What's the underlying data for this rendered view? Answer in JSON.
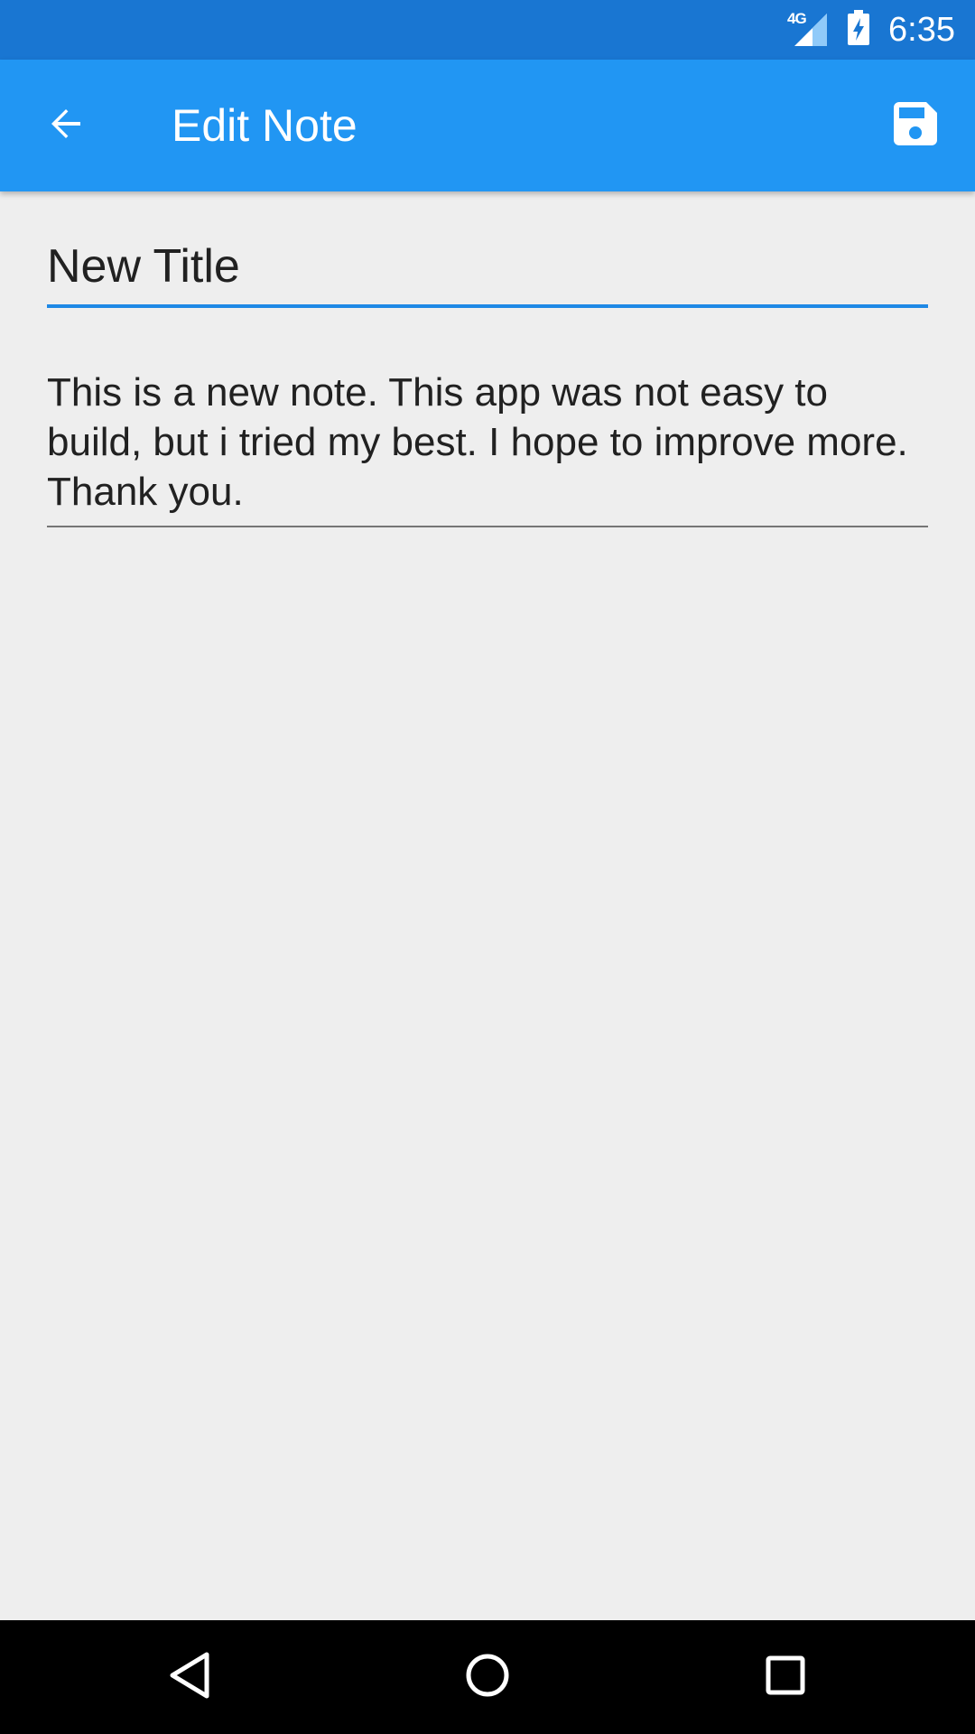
{
  "status_bar": {
    "network_type": "4G",
    "time": "6:35"
  },
  "app_bar": {
    "title": "Edit Note",
    "back_icon": "arrow-back-icon",
    "save_icon": "save-floppy-icon"
  },
  "note": {
    "title": "New Title",
    "body": "This is a new note. This app was not easy to build, but i tried my best. I hope to improve more. Thank you."
  },
  "nav_bar": {
    "icons": [
      "nav-back-icon",
      "nav-home-icon",
      "nav-recents-icon"
    ]
  },
  "colors": {
    "status_bar": "#1976d2",
    "app_bar": "#2196f3",
    "background": "#eeeeee",
    "accent_underline": "#1e88e5"
  }
}
